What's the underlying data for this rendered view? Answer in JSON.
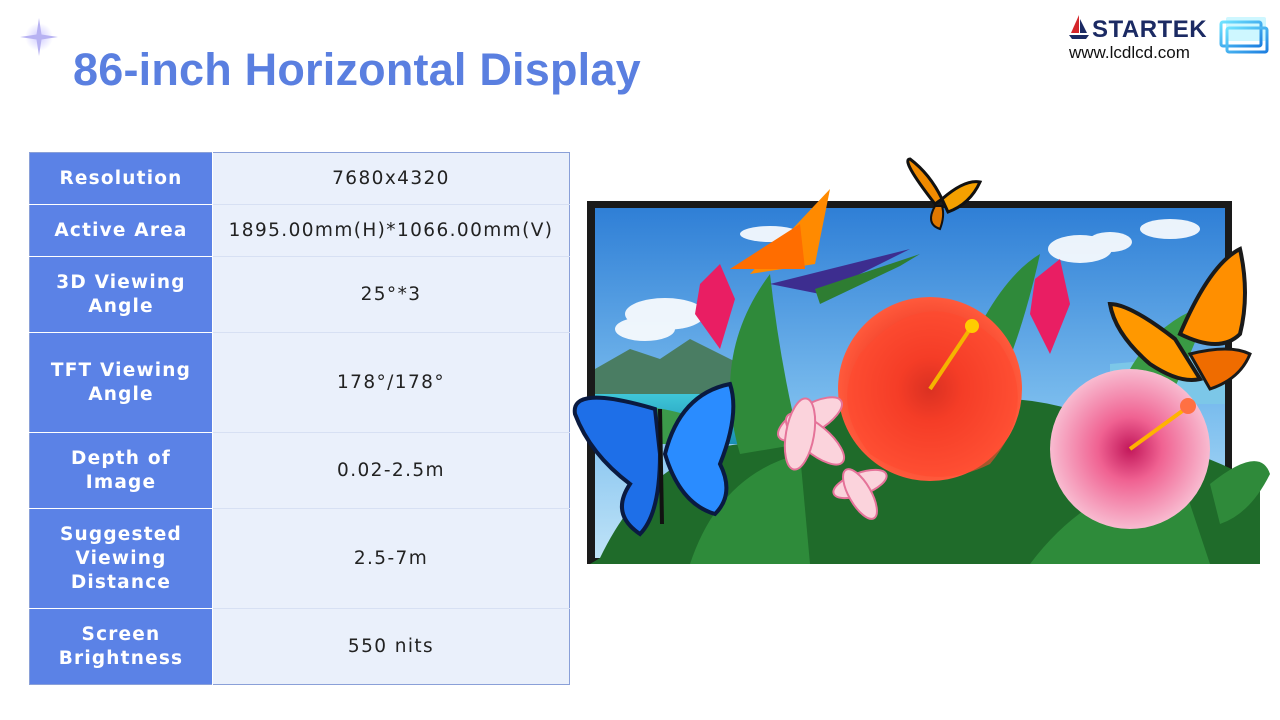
{
  "slide": {
    "title": "86-inch Horizontal Display"
  },
  "logo": {
    "brand": "STARTEK",
    "url": "www.lcdlcd.com"
  },
  "specs": [
    {
      "label": "Resolution",
      "value": "7680x4320"
    },
    {
      "label": "Active Area",
      "value": "1895.00mm(H)*1066.00mm(V)"
    },
    {
      "label": "3D Viewing Angle",
      "value": "25°*3"
    },
    {
      "label": "TFT Viewing Angle",
      "value": "178°/178°"
    },
    {
      "label": "Depth of Image",
      "value": "0.02-2.5m"
    },
    {
      "label": "Suggested Viewing Distance",
      "value": "2.5-7m"
    },
    {
      "label": "Screen Brightness",
      "value": "550 nits"
    }
  ],
  "colors": {
    "title": "#5a7fe0",
    "label_bg": "#5b82e6",
    "value_bg": "#eaf0fb",
    "brand": "#1b2a63"
  }
}
